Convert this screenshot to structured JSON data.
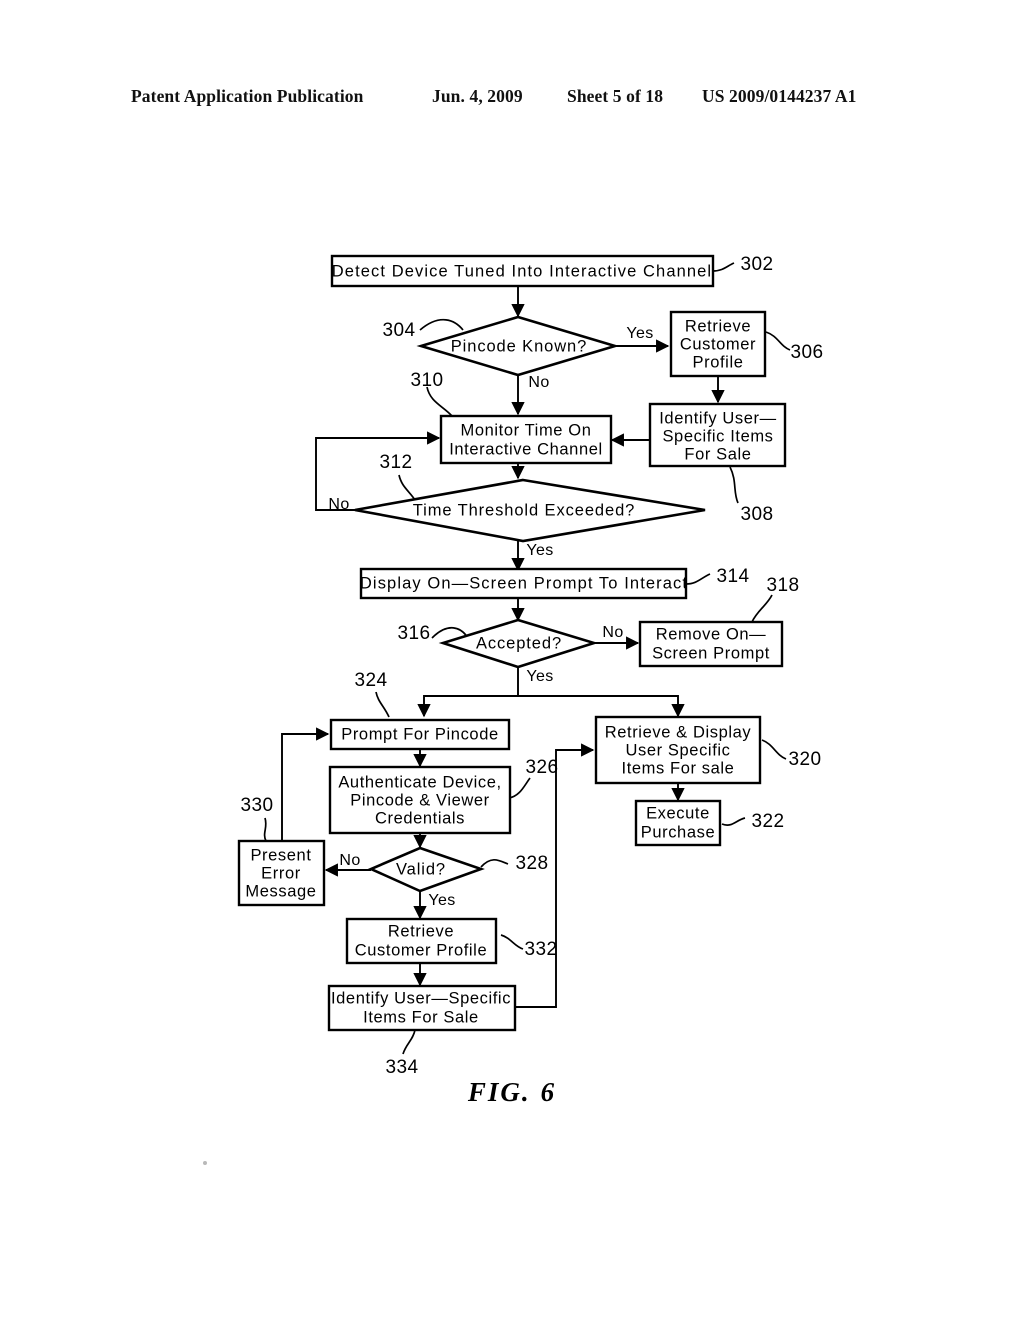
{
  "header": {
    "publication": "Patent Application Publication",
    "date": "Jun. 4, 2009",
    "sheet": "Sheet 5 of 18",
    "patent_number": "US 2009/0144237 A1"
  },
  "figure": {
    "caption_label": "FIG.",
    "caption_number": "6"
  },
  "nodes": {
    "n302": {
      "ref": "302",
      "lines": [
        "Detect Device Tuned Into Interactive Channel"
      ]
    },
    "n304": {
      "ref": "304",
      "lines": [
        "Pincode  Known?"
      ]
    },
    "n306": {
      "ref": "306",
      "lines": [
        "Retrieve",
        "Customer",
        "Profile"
      ]
    },
    "n308": {
      "ref": "308",
      "lines": [
        "Identify  User—",
        "Specific  Items",
        "For  Sale"
      ]
    },
    "n310": {
      "ref": "310",
      "lines": [
        "Monitor  Time  On",
        "Interactive  Channel"
      ]
    },
    "n312": {
      "ref": "312",
      "lines": [
        "Time  Threshold  Exceeded?"
      ]
    },
    "n314": {
      "ref": "314",
      "lines": [
        "Display On—Screen Prompt To Interact"
      ]
    },
    "n316": {
      "ref": "316",
      "lines": [
        "Accepted?"
      ]
    },
    "n318": {
      "ref": "318",
      "lines": [
        "Remove  On—",
        "Screen  Prompt"
      ]
    },
    "n320": {
      "ref": "320",
      "lines": [
        "Retrieve  &  Display",
        "User  Specific",
        "Items  For  sale"
      ]
    },
    "n322": {
      "ref": "322",
      "lines": [
        "Execute",
        "Purchase"
      ]
    },
    "n324": {
      "ref": "324",
      "lines": [
        "Prompt  For  Pincode"
      ]
    },
    "n326": {
      "ref": "326",
      "lines": [
        "Authenticate  Device,",
        "Pincode  &  Viewer",
        "Credentials"
      ]
    },
    "n328": {
      "ref": "328",
      "lines": [
        "Valid?"
      ]
    },
    "n330": {
      "ref": "330",
      "lines": [
        "Present",
        "Error",
        "Message"
      ]
    },
    "n332": {
      "ref": "332",
      "lines": [
        "Retrieve",
        "Customer  Profile"
      ]
    },
    "n334": {
      "ref": "334",
      "lines": [
        "Identify  User—Specific",
        "Items  For  Sale"
      ]
    }
  },
  "edge_labels": {
    "pincode_yes": "Yes",
    "pincode_no": "No",
    "threshold_no": "No",
    "threshold_yes": "Yes",
    "accepted_no": "No",
    "accepted_yes": "Yes",
    "valid_no": "No",
    "valid_yes": "Yes"
  },
  "colors": {
    "ink": "#000000",
    "paper": "#ffffff"
  }
}
